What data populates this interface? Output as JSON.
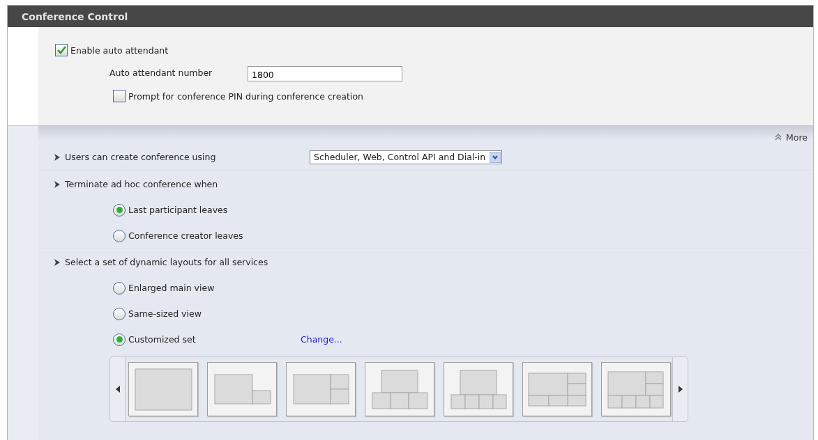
{
  "header": {
    "title": "Conference Control"
  },
  "auto_attendant": {
    "label": "Enable auto attendant",
    "checked": true
  },
  "number_field": {
    "label": "Auto attendant number",
    "value": "1800"
  },
  "pin_prompt": {
    "label": "Prompt for conference PIN during conference creation",
    "checked": false
  },
  "more_toggle": {
    "label": "More",
    "expanded": true
  },
  "sections": [
    {
      "kind": "dropdown",
      "title": "Users can create conference using",
      "value": "Scheduler, Web, Control API and Dial-in"
    },
    {
      "kind": "radios",
      "title": "Terminate ad hoc conference when",
      "options": [
        {
          "label": "Last participant leaves",
          "selected": true
        },
        {
          "label": "Conference creator leaves",
          "selected": false
        }
      ]
    },
    {
      "kind": "radios",
      "title": "Select a set of dynamic layouts for all services",
      "options": [
        {
          "label": "Enlarged main view",
          "selected": false
        },
        {
          "label": "Same-sized view",
          "selected": false
        },
        {
          "label": "Customized set",
          "selected": true,
          "link": "Change..."
        }
      ],
      "layouts": [
        {
          "kind": "full"
        },
        {
          "kind": "main-corner"
        },
        {
          "kind": "main-side2"
        },
        {
          "kind": "top-bottom3"
        },
        {
          "kind": "top-bottom4"
        },
        {
          "kind": "main-side3-bottom2"
        },
        {
          "kind": "main-side2-bottom4"
        }
      ]
    }
  ]
}
